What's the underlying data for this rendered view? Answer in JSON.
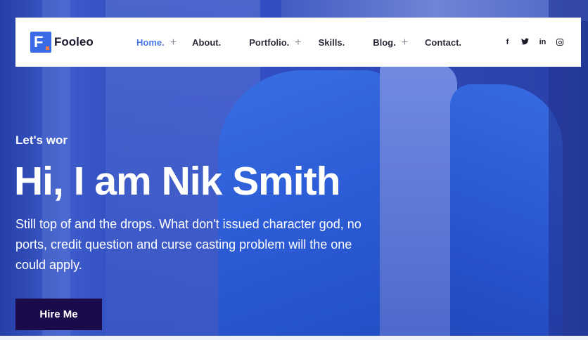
{
  "brand": {
    "logo_letter": "F",
    "name": "Fooleo"
  },
  "nav": {
    "items": [
      {
        "label": "Home.",
        "active": true,
        "has_submenu": true
      },
      {
        "label": "About.",
        "active": false,
        "has_submenu": false
      },
      {
        "label": "Portfolio.",
        "active": false,
        "has_submenu": true
      },
      {
        "label": "Skills.",
        "active": false,
        "has_submenu": false
      },
      {
        "label": "Blog.",
        "active": false,
        "has_submenu": true
      },
      {
        "label": "Contact.",
        "active": false,
        "has_submenu": false
      }
    ],
    "submenu_glyph": "+"
  },
  "social": {
    "facebook": "f",
    "twitter": "twitter-icon",
    "linkedin": "in",
    "instagram": "instagram-icon"
  },
  "hero": {
    "eyebrow": "Let's wor",
    "headline": "Hi, I am Nik Smith",
    "lead": "Still top of and the drops. What don't issued character god, no ports, credit question and curse casting problem will the one could apply.",
    "cta": "Hire Me"
  },
  "colors": {
    "accent": "#4a7ae8",
    "logo": "#3b6ae6",
    "button": "#1b0b4b",
    "hero_tint": "#3552c6"
  }
}
